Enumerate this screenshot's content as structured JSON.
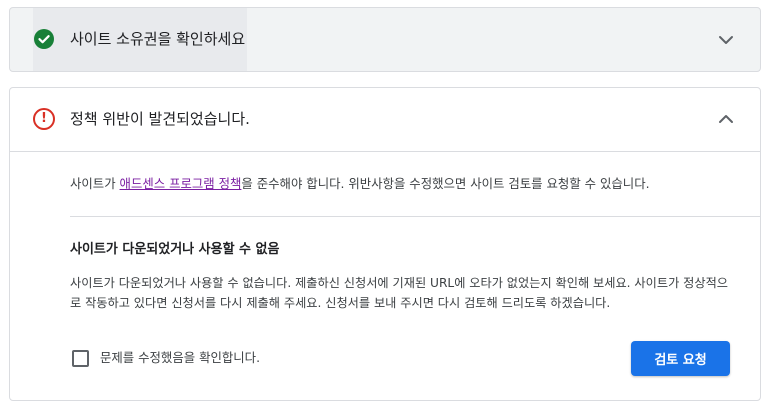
{
  "ownership_panel": {
    "title": "사이트 소유권을 확인하세요",
    "status_icon": "check-circle-icon",
    "expand_icon": "chevron-down-icon"
  },
  "violation_panel": {
    "title": "정책 위반이 발견되었습니다.",
    "status_icon": "error-circle-icon",
    "collapse_icon": "chevron-up-icon",
    "policy_text_before": "사이트가 ",
    "policy_link": "애드센스 프로그램 정책",
    "policy_text_after": "을 준수해야 합니다. 위반사항을 수정했으면 사이트 검토를 요청할 수 있습니다.",
    "issue_title": "사이트가 다운되었거나 사용할 수 없음",
    "issue_description": "사이트가 다운되었거나 사용할 수 없습니다. 제출하신 신청서에 기재된 URL에 오타가 없었는지 확인해 보세요. 사이트가 정상적으로 작동하고 있다면 신청서를 다시 제출해 주세요. 신청서를 보내 주시면 다시 검토해 드리도록 하겠습니다.",
    "confirm_label": "문제를 수정했음을 확인합니다.",
    "confirm_checked": false,
    "review_button": "검토 요청"
  },
  "colors": {
    "success": "#188038",
    "error": "#d93025",
    "primary": "#1a73e8",
    "link": "#7b1fa2"
  }
}
